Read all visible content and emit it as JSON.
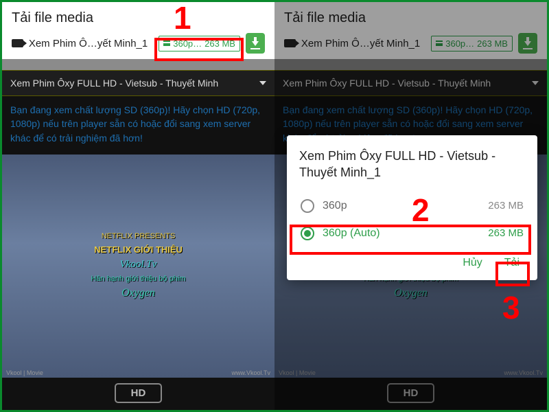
{
  "header": {
    "title": "Tải file media"
  },
  "file": {
    "name": "Xem Phim Ô…yết Minh_1",
    "quality": "360p…",
    "size": "263 MB"
  },
  "accordion": {
    "title": "Xem Phim Ôxy FULL HD - Vietsub - Thuyết Minh"
  },
  "message": "Bạn đang xem chất lượng SD (360p)! Hãy chọn HD (720p, 1080p) nếu trên player sẵn có hoặc đổi sang xem server khác để có trải nghiệm đã hơn!",
  "video_subs": {
    "l1": "NETFLIX PRESENTS",
    "l2": "NETFLIX GIỚI THIỆU",
    "l3": "Vkool.Tv",
    "l4": "Hân hạnh giới thiệu bộ phim",
    "l5": "Oxygen",
    "wl": "Vkool | Movie",
    "wr": "www.Vkool.Tv"
  },
  "hd_label": "HD",
  "dialog": {
    "title": "Xem Phim Ôxy FULL HD - Vietsub - Thuyết Minh_1",
    "options": [
      {
        "label": "360p",
        "size": "263 MB",
        "selected": false
      },
      {
        "label": "360p (Auto)",
        "size": "263 MB",
        "selected": true
      }
    ],
    "cancel": "Hủy",
    "download": "Tải"
  },
  "nums": {
    "n1": "1",
    "n2": "2",
    "n3": "3"
  }
}
